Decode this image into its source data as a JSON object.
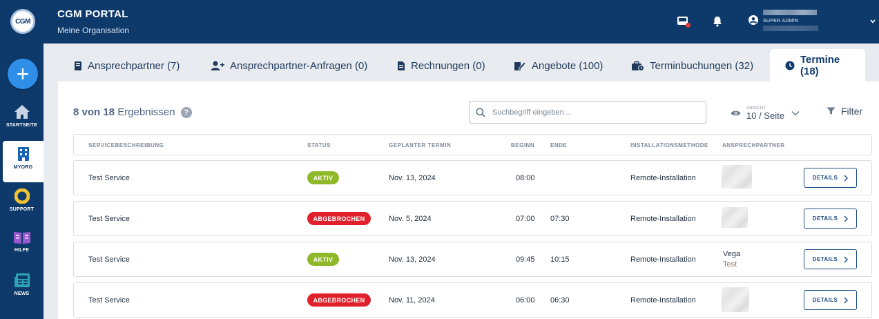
{
  "header": {
    "logo_text": "CGM",
    "title": "CGM PORTAL",
    "subtitle": "Meine Organisation",
    "user_role": "SUPER ADMIN"
  },
  "sidebar": {
    "add_label": "+",
    "items": [
      {
        "label": "STARTSEITE",
        "icon": "home-icon"
      },
      {
        "label": "MYORG",
        "icon": "building-icon"
      },
      {
        "label": "SUPPORT",
        "icon": "lifebuoy-icon"
      },
      {
        "label": "HILFE",
        "icon": "book-icon"
      },
      {
        "label": "NEWS",
        "icon": "newspaper-icon"
      }
    ]
  },
  "tabs": [
    {
      "label": "Ansprechpartner (7)",
      "icon": "contact-book-icon"
    },
    {
      "label": "Ansprechpartner-Anfragen (0)",
      "icon": "add-user-icon"
    },
    {
      "label": "Rechnungen (0)",
      "icon": "invoice-icon"
    },
    {
      "label": "Angebote (100)",
      "icon": "signature-icon"
    },
    {
      "label": "Terminbuchungen (32)",
      "icon": "briefcase-clock-icon"
    },
    {
      "label": "Termine (18)",
      "icon": "clock-icon",
      "active": true
    }
  ],
  "toolbar": {
    "results_count": "8 von 18",
    "results_label": "Ergebnissen",
    "help": "?",
    "search_placeholder": "Suchbegriff eingeben...",
    "view_label": "ANSICHT",
    "view_value": "10 / Seite",
    "filter_label": "Filter"
  },
  "table": {
    "columns": [
      "SERVICEBESCHREIBUNG",
      "STATUS",
      "GEPLANTER TERMIN",
      "BEGINN",
      "ENDE",
      "INSTALLATIONSMETHODE",
      "ANSPRECHPARTNER"
    ],
    "details_label": "DETAILS",
    "rows": [
      {
        "service": "Test Service",
        "status": "AKTIV",
        "date": "Nov. 13, 2024",
        "start": "08:00",
        "end": "",
        "method": "Remote-Installation",
        "contact_name": "",
        "contact_sub": ""
      },
      {
        "service": "Test Service",
        "status": "ABGEBROCHEN",
        "date": "Nov. 5, 2024",
        "start": "07:00",
        "end": "07:30",
        "method": "Remote-Installation",
        "contact_name": "",
        "contact_sub": ""
      },
      {
        "service": "Test Service",
        "status": "AKTIV",
        "date": "Nov. 13, 2024",
        "start": "09:45",
        "end": "10:15",
        "method": "Remote-Installation",
        "contact_name": "Vega",
        "contact_sub": "Test"
      },
      {
        "service": "Test Service",
        "status": "ABGEBROCHEN",
        "date": "Nov. 11, 2024",
        "start": "06:00",
        "end": "06:30",
        "method": "Remote-Installation",
        "contact_name": "",
        "contact_sub": ""
      }
    ]
  },
  "colors": {
    "brand_navy": "#0e3a6b",
    "accent_blue": "#2f8fe8",
    "status_active": "#8fb82a",
    "status_cancelled": "#e0202a"
  }
}
